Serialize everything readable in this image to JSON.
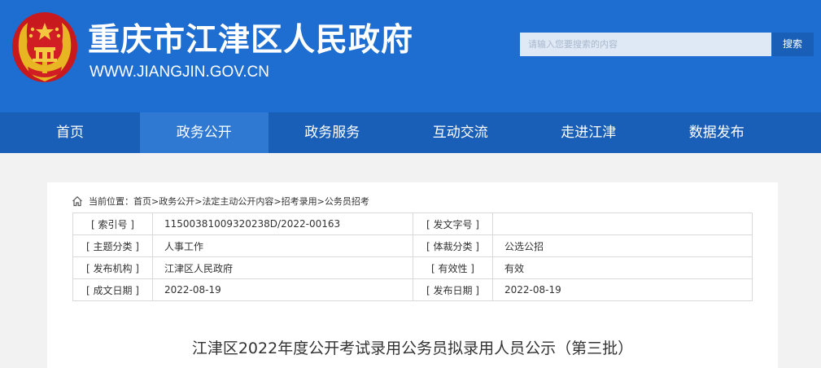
{
  "header": {
    "site_title": "重庆市江津区人民政府",
    "site_url": "WWW.JIANGJIN.GOV.CN",
    "emblem_icon": "national-emblem-icon",
    "bg_color": "#1e6dd0"
  },
  "search": {
    "placeholder": "请输入您要搜索的内容",
    "button_label": "搜索"
  },
  "nav": {
    "items": [
      {
        "label": "首页"
      },
      {
        "label": "政务公开"
      },
      {
        "label": "政务服务"
      },
      {
        "label": "互动交流"
      },
      {
        "label": "走进江津"
      },
      {
        "label": "数据发布"
      }
    ],
    "active_index": 1,
    "bg_color": "#1a5fb7",
    "active_color": "#3079d2"
  },
  "breadcrumb": {
    "prefix": "当前位置：",
    "items": [
      "首页",
      "政务公开",
      "法定主动公开内容",
      "招考录用",
      "公务员招考"
    ],
    "separator": ">"
  },
  "meta": {
    "index_no_label": "[ 索引号 ]",
    "index_no_value": "11500381009320238D/2022-00163",
    "doc_no_label": "[ 发文字号 ]",
    "doc_no_value": "",
    "topic_label": "[ 主题分类 ]",
    "topic_value": "人事工作",
    "genre_label": "[ 体裁分类 ]",
    "genre_value": "公选公招",
    "issuer_label": "[ 发布机构 ]",
    "issuer_value": "江津区人民政府",
    "validity_label": "[ 有效性 ]",
    "validity_value": "有效",
    "created_label": "[ 成文日期 ]",
    "created_value": "2022-08-19",
    "published_label": "[ 发布日期 ]",
    "published_value": "2022-08-19"
  },
  "article": {
    "title": "江津区2022年度公开考试录用公务员拟录用人员公示（第三批）"
  }
}
